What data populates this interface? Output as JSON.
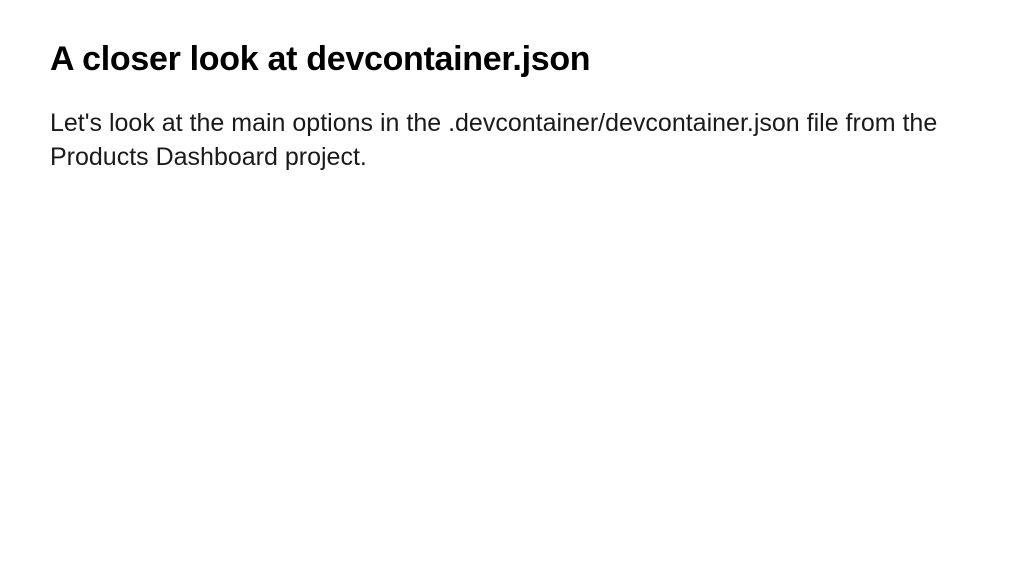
{
  "heading": "A closer look at devcontainer.json",
  "body": "Let's look at the main options in the .devcontainer/devcontainer.json file from the Products Dashboard project."
}
